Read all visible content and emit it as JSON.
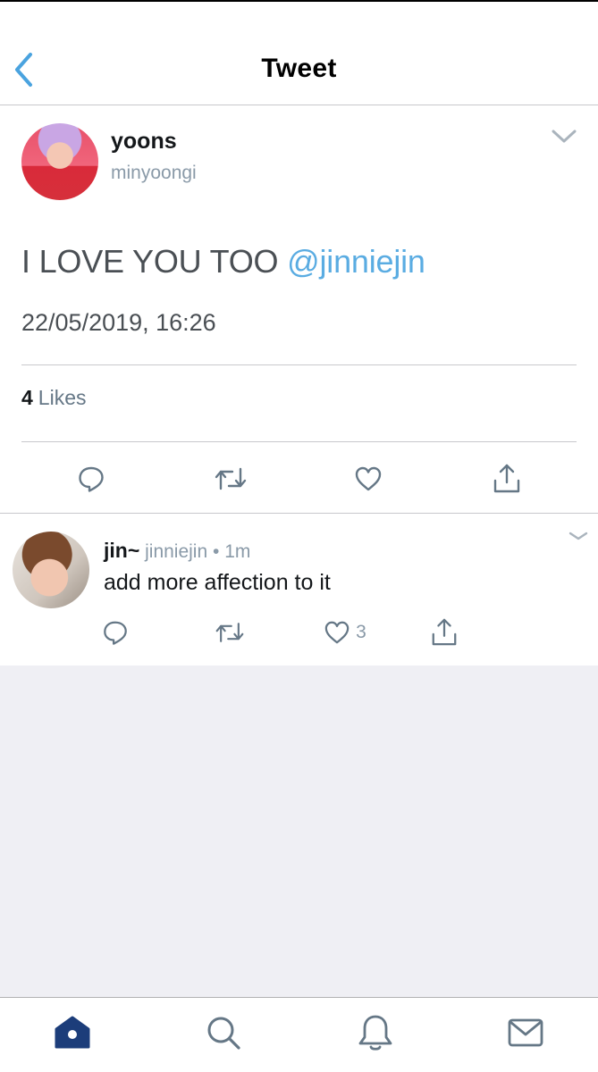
{
  "header": {
    "title": "Tweet"
  },
  "tweet": {
    "author_name": "yoons",
    "author_handle": "minyoongi",
    "text": "I LOVE YOU TOO",
    "mention": "@jinniejin",
    "datetime": "22/05/2019, 16:26",
    "likes_count": "4",
    "likes_label": "Likes"
  },
  "reply": {
    "author_name": "jin~",
    "author_handle": "jinniejin",
    "separator": "•",
    "time": "1m",
    "text": "add more affection to it",
    "like_count": "3"
  },
  "icons": {
    "back": "chevron-left-icon",
    "more": "chevron-down-icon",
    "reply": "comment-icon",
    "retweet": "retweet-icon",
    "like": "heart-icon",
    "share": "share-icon",
    "tabs": [
      "home-icon",
      "search-icon",
      "bell-icon",
      "mail-icon"
    ]
  },
  "colors": {
    "accent": "#1d9bf0",
    "mention": "#5aace2",
    "tab_active": "#1c3d7a",
    "icon": "#657786",
    "background": "#efeff4"
  }
}
